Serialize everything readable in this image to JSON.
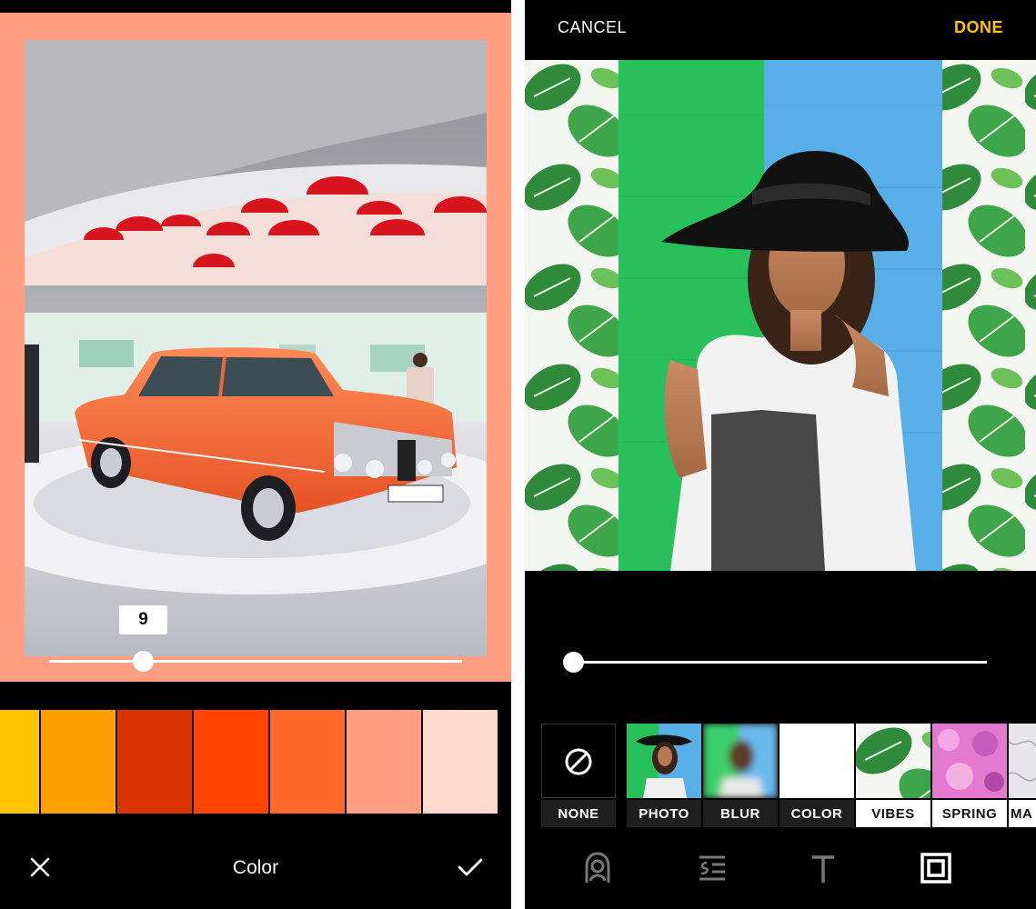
{
  "left_screen": {
    "frame_color": "#FF9E80",
    "slider": {
      "badge_value": "9",
      "fraction": 0.2
    },
    "swatches": [
      "#FFC300",
      "#FFA000",
      "#D83300",
      "#FF4500",
      "#FF6A2B",
      "#FF9E80",
      "#FFD9CE"
    ],
    "bottom_bar": {
      "title": "Color"
    },
    "icons": {
      "close": "close-icon",
      "confirm": "checkmark-icon"
    }
  },
  "right_screen": {
    "top_bar": {
      "cancel_label": "CANCEL",
      "done_label": "DONE",
      "done_color": "#FFC400"
    },
    "slider": {
      "fraction": 0.0
    },
    "background_options": [
      {
        "label": "NONE",
        "icon": "no-symbol-icon"
      },
      {
        "label": "PHOTO"
      },
      {
        "label": "BLUR"
      },
      {
        "label": "COLOR"
      },
      {
        "label": "VIBES"
      },
      {
        "label": "SPRING"
      },
      {
        "label": "MA"
      }
    ],
    "toolbar_icons": [
      "face-icon",
      "text-align-icon",
      "text-icon",
      "frame-icon"
    ]
  }
}
